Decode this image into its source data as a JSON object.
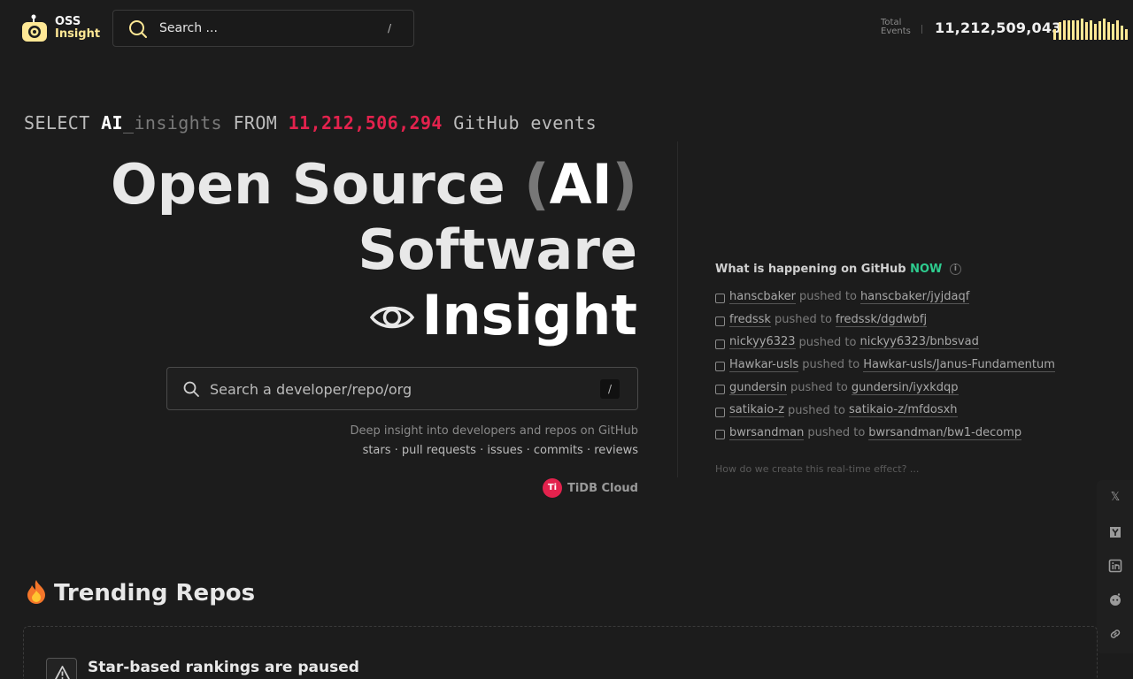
{
  "header": {
    "logo": {
      "line1": "OSS",
      "line2": "Insight"
    },
    "search": {
      "placeholder": "Search ...",
      "shortcut": "/"
    },
    "total_events": {
      "label_line1": "Total",
      "label_line2": "Events",
      "value": "11,212,509,043"
    },
    "colors": {
      "accent": "#FFE895",
      "brand_red": "#e3224d",
      "live_green": "#2ecc8f"
    }
  },
  "hero": {
    "sql": {
      "kw_select": "SELECT",
      "ai": "AI",
      "insights": "_insights",
      "kw_from": "FROM",
      "count": "11,212,506,294",
      "tail": "GitHub events"
    },
    "title": {
      "open_source": "Open Source",
      "paren_open": "(",
      "ai": "AI",
      "paren_close": ")",
      "software": "Software",
      "insight": "Insight"
    },
    "search": {
      "placeholder": "Search a developer/repo/org",
      "shortcut": "/"
    },
    "tagline": "Deep insight into developers and repos on GitHub",
    "features": "stars · pull requests · issues · commits · reviews",
    "powered_by": "TiDB Cloud"
  },
  "live_feed": {
    "title_prefix": "What is happening on GitHub",
    "title_now": "NOW",
    "events": [
      {
        "user": "hanscbaker",
        "verb": "pushed to",
        "repo": "hanscbaker/jyjdaqf"
      },
      {
        "user": "fredssk",
        "verb": "pushed to",
        "repo": "fredssk/dgdwbfj"
      },
      {
        "user": "nickyy6323",
        "verb": "pushed to",
        "repo": "nickyy6323/bnbsvad"
      },
      {
        "user": "Hawkar-usls",
        "verb": "pushed to",
        "repo": "Hawkar-usls/Janus-Fundamentum"
      },
      {
        "user": "gundersin",
        "verb": "pushed to",
        "repo": "gundersin/iyxkdqp"
      },
      {
        "user": "satikaio-z",
        "verb": "pushed to",
        "repo": "satikaio-z/mfdosxh"
      },
      {
        "user": "bwrsandman",
        "verb": "pushed to",
        "repo": "bwrsandman/bw1-decomp"
      }
    ],
    "footer": "How do we create this real-time effect? ..."
  },
  "social": [
    "x-icon",
    "ycombinator-icon",
    "linkedin-icon",
    "reddit-icon",
    "link-icon"
  ],
  "trending": {
    "title": "Trending Repos",
    "notice": "Star-based rankings are paused"
  }
}
